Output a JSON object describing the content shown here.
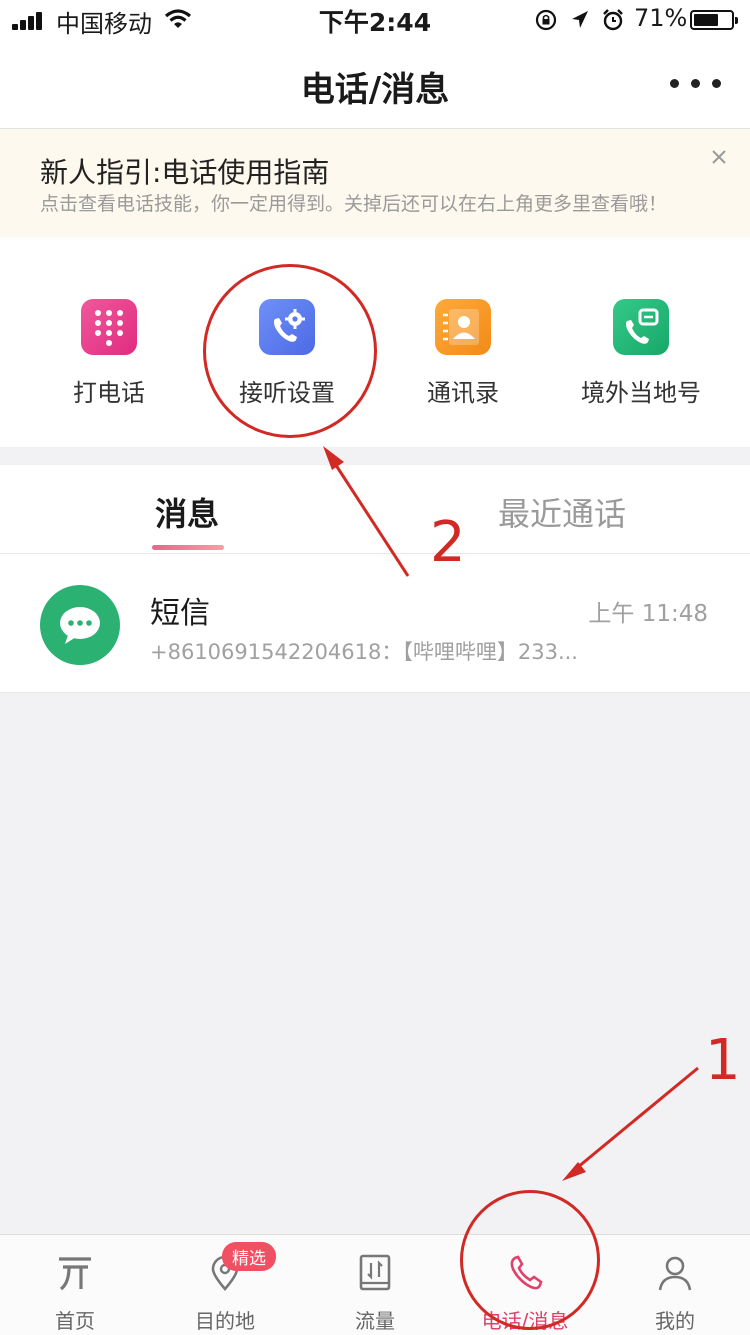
{
  "status_bar": {
    "carrier": "中国移动",
    "time": "下午2:44",
    "battery_percent": "71%",
    "battery_level": 0.71,
    "icons": [
      "signal-icon",
      "wifi-icon",
      "lock-rotation-icon",
      "location-icon",
      "alarm-icon",
      "battery-icon"
    ]
  },
  "nav": {
    "title": "电话/消息",
    "more_icon": "more-icon"
  },
  "guide_banner": {
    "title": "新人指引:电话使用指南",
    "subtitle": "点击查看电话技能，你一定用得到。关掉后还可以在右上角更多里查看哦！",
    "close_icon": "close-icon"
  },
  "quick_actions": [
    {
      "label": "打电话",
      "icon": "dialpad-icon",
      "color": "#ec3c8e"
    },
    {
      "label": "接听设置",
      "icon": "phone-settings-icon",
      "color": "#5d7ff2"
    },
    {
      "label": "通讯录",
      "icon": "contacts-book-icon",
      "color": "#f59a2a"
    },
    {
      "label": "境外当地号",
      "icon": "phone-sim-icon",
      "color": "#21b87a"
    }
  ],
  "tabs": [
    {
      "label": "消息",
      "active": true
    },
    {
      "label": "最近通话",
      "active": false
    }
  ],
  "messages": [
    {
      "name": "短信",
      "time": "上午 11:48",
      "preview": "+8610691542204618：【哔哩哔哩】233...",
      "icon": "sms-chat-icon"
    }
  ],
  "tab_bar": [
    {
      "label": "首页",
      "icon": "home-logo-icon",
      "active": false
    },
    {
      "label": "目的地",
      "icon": "location-pin-icon",
      "active": false,
      "badge": "精选"
    },
    {
      "label": "流量",
      "icon": "data-traffic-icon",
      "active": false
    },
    {
      "label": "电话/消息",
      "icon": "phone-icon",
      "active": true
    },
    {
      "label": "我的",
      "icon": "profile-icon",
      "active": false
    }
  ],
  "annotations": {
    "step_1": "1",
    "step_2": "2",
    "color": "#d12a25"
  }
}
